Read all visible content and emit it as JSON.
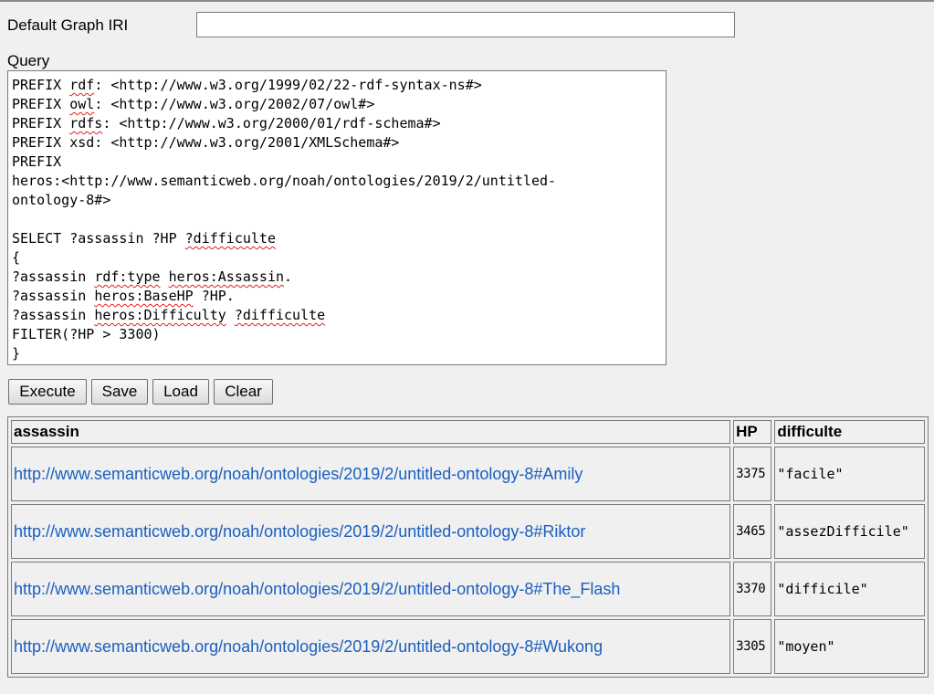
{
  "default_graph": {
    "label": "Default Graph IRI",
    "value": ""
  },
  "query": {
    "label": "Query",
    "lines": [
      [
        {
          "t": "PREFIX "
        },
        {
          "t": "rdf",
          "sp": true
        },
        {
          "t": ": <http://www.w3.org/1999/02/22-rdf-syntax-ns#>"
        }
      ],
      [
        {
          "t": "PREFIX "
        },
        {
          "t": "owl",
          "sp": true
        },
        {
          "t": ": <http://www.w3.org/2002/07/owl#>"
        }
      ],
      [
        {
          "t": "PREFIX "
        },
        {
          "t": "rdfs",
          "sp": true
        },
        {
          "t": ": <http://www.w3.org/2000/01/rdf-schema#>"
        }
      ],
      [
        {
          "t": "PREFIX xsd: <http://www.w3.org/2001/XMLSchema#>"
        }
      ],
      [
        {
          "t": "PREFIX"
        }
      ],
      [
        {
          "t": "heros:<http://www.semanticweb.org/noah/ontologies/2019/2/untitled-"
        }
      ],
      [
        {
          "t": "ontology-8#>"
        }
      ],
      [
        {
          "t": ""
        }
      ],
      [
        {
          "t": "SELECT ?assassin ?HP "
        },
        {
          "t": "?difficulte",
          "sp": true
        }
      ],
      [
        {
          "t": "{"
        }
      ],
      [
        {
          "t": "?assassin "
        },
        {
          "t": "rdf:type",
          "sp": true
        },
        {
          "t": " "
        },
        {
          "t": "heros:Assassin",
          "sp": true
        },
        {
          "t": "."
        }
      ],
      [
        {
          "t": "?assassin "
        },
        {
          "t": "heros:BaseHP",
          "sp": true
        },
        {
          "t": " ?HP."
        }
      ],
      [
        {
          "t": "?assassin "
        },
        {
          "t": "heros:Difficulty",
          "sp": true
        },
        {
          "t": " "
        },
        {
          "t": "?difficulte",
          "sp": true
        }
      ],
      [
        {
          "t": "FILTER(?HP > 3300)"
        }
      ],
      [
        {
          "t": "}"
        }
      ]
    ]
  },
  "buttons": {
    "execute": "Execute",
    "save": "Save",
    "load": "Load",
    "clear": "Clear"
  },
  "results": {
    "headers": [
      "assassin",
      "HP",
      "difficulte"
    ],
    "rows": [
      {
        "assassin": "http://www.semanticweb.org/noah/ontologies/2019/2/untitled-ontology-8#Amily",
        "hp": "3375",
        "difficulte": "\"facile\""
      },
      {
        "assassin": "http://www.semanticweb.org/noah/ontologies/2019/2/untitled-ontology-8#Riktor",
        "hp": "3465",
        "difficulte": "\"assezDifficile\""
      },
      {
        "assassin": "http://www.semanticweb.org/noah/ontologies/2019/2/untitled-ontology-8#The_Flash",
        "hp": "3370",
        "difficulte": "\"difficile\""
      },
      {
        "assassin": "http://www.semanticweb.org/noah/ontologies/2019/2/untitled-ontology-8#Wukong",
        "hp": "3305",
        "difficulte": "\"moyen\""
      }
    ]
  },
  "colors": {
    "link": "#1a5fbf",
    "spellcheck": "#e0201c",
    "background": "#f0f0f0"
  }
}
